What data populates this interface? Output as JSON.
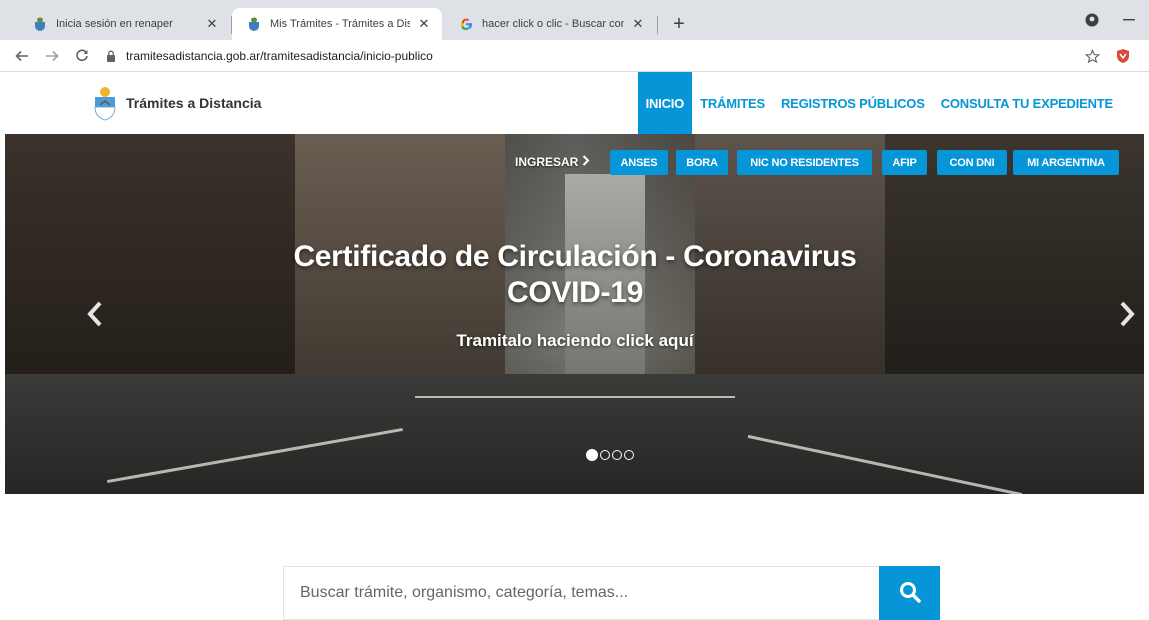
{
  "browser": {
    "tabs": [
      {
        "title": "Inicia sesión en renaper",
        "close": "✕"
      },
      {
        "title": "Mis Trámites - Trámites a Distanc",
        "close": "✕"
      },
      {
        "title": "hacer click o clic - Buscar con Go",
        "close": "✕"
      }
    ],
    "new_tab": "+",
    "url": "tramitesadistancia.gob.ar/tramitesadistancia/inicio-publico"
  },
  "site": {
    "brand": "Trámites a Distancia",
    "nav": [
      "INICIO",
      "TRÁMITES",
      "REGISTROS PÚBLICOS",
      "CONSULTA TU EXPEDIENTE"
    ]
  },
  "hero": {
    "ingresar": "INGRESAR",
    "quick_links": [
      "ANSES",
      "BORA",
      "NIC NO RESIDENTES",
      "AFIP",
      "CON DNI",
      "MI ARGENTINA"
    ],
    "title": "Certificado de Circulación - Coronavirus COVID-19",
    "subtitle": "Tramitalo haciendo click aquí",
    "active_slide": 1,
    "slide_count": 4
  },
  "search": {
    "placeholder": "Buscar trámite, organismo, categoría, temas..."
  },
  "colors": {
    "accent": "#0695d6",
    "tabstrip": "#dee1e6"
  },
  "icons": [
    "shield-favicon-icon",
    "google-favicon-icon",
    "back-icon",
    "forward-icon",
    "reload-icon",
    "lock-icon",
    "star-icon",
    "extension-icon",
    "prev-arrow-icon",
    "next-arrow-icon",
    "search-icon",
    "profile-icon",
    "minimize-icon"
  ]
}
